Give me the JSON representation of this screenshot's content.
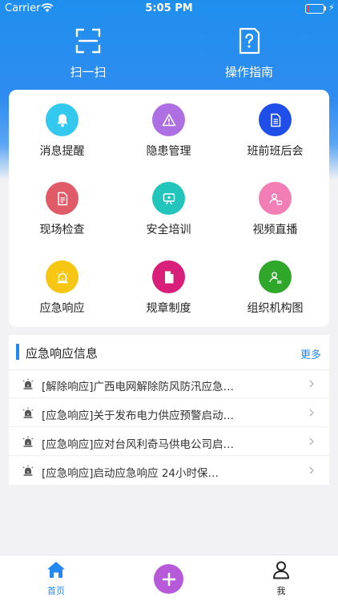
{
  "status_bar": {
    "carrier": "Carrier",
    "time": "5:05 PM",
    "battery_level": 0.15
  },
  "quick_actions": [
    {
      "label": "扫一扫",
      "icon": "scan-icon"
    },
    {
      "label": "操作指南",
      "icon": "guide-icon"
    }
  ],
  "grid": [
    {
      "label": "消息提醒",
      "icon": "bell-icon",
      "color": "#33c9ee"
    },
    {
      "label": "隐患管理",
      "icon": "warning-icon",
      "color": "#ae6fe2"
    },
    {
      "label": "班前班后会",
      "icon": "document-icon",
      "color": "#1f4fe8"
    },
    {
      "label": "现场检查",
      "icon": "checklist-icon",
      "color": "#e05a67"
    },
    {
      "label": "安全培训",
      "icon": "training-icon",
      "color": "#21c5bb"
    },
    {
      "label": "视频直播",
      "icon": "live-video-icon",
      "color": "#f17fb5"
    },
    {
      "label": "应急响应",
      "icon": "siren-icon",
      "color": "#f6c613"
    },
    {
      "label": "规章制度",
      "icon": "file-icon",
      "color": "#d8207b"
    },
    {
      "label": "组织机构图",
      "icon": "org-chart-icon",
      "color": "#2fa72a"
    }
  ],
  "news": {
    "title": "应急响应信息",
    "more": "更多",
    "items": [
      {
        "text": "[解除响应]广西电网解除防风防汛应急…"
      },
      {
        "text": "[应急响应]关于发布电力供应预警启动…"
      },
      {
        "text": "[应急响应]应对台风利奇马供电公司启…"
      },
      {
        "text": "[应急响应]启动应急响应 24小时保…"
      }
    ]
  },
  "tabbar": {
    "home": "首页",
    "me": "我"
  },
  "colors": {
    "primary": "#2587f0",
    "fab": "#b65ad9"
  }
}
